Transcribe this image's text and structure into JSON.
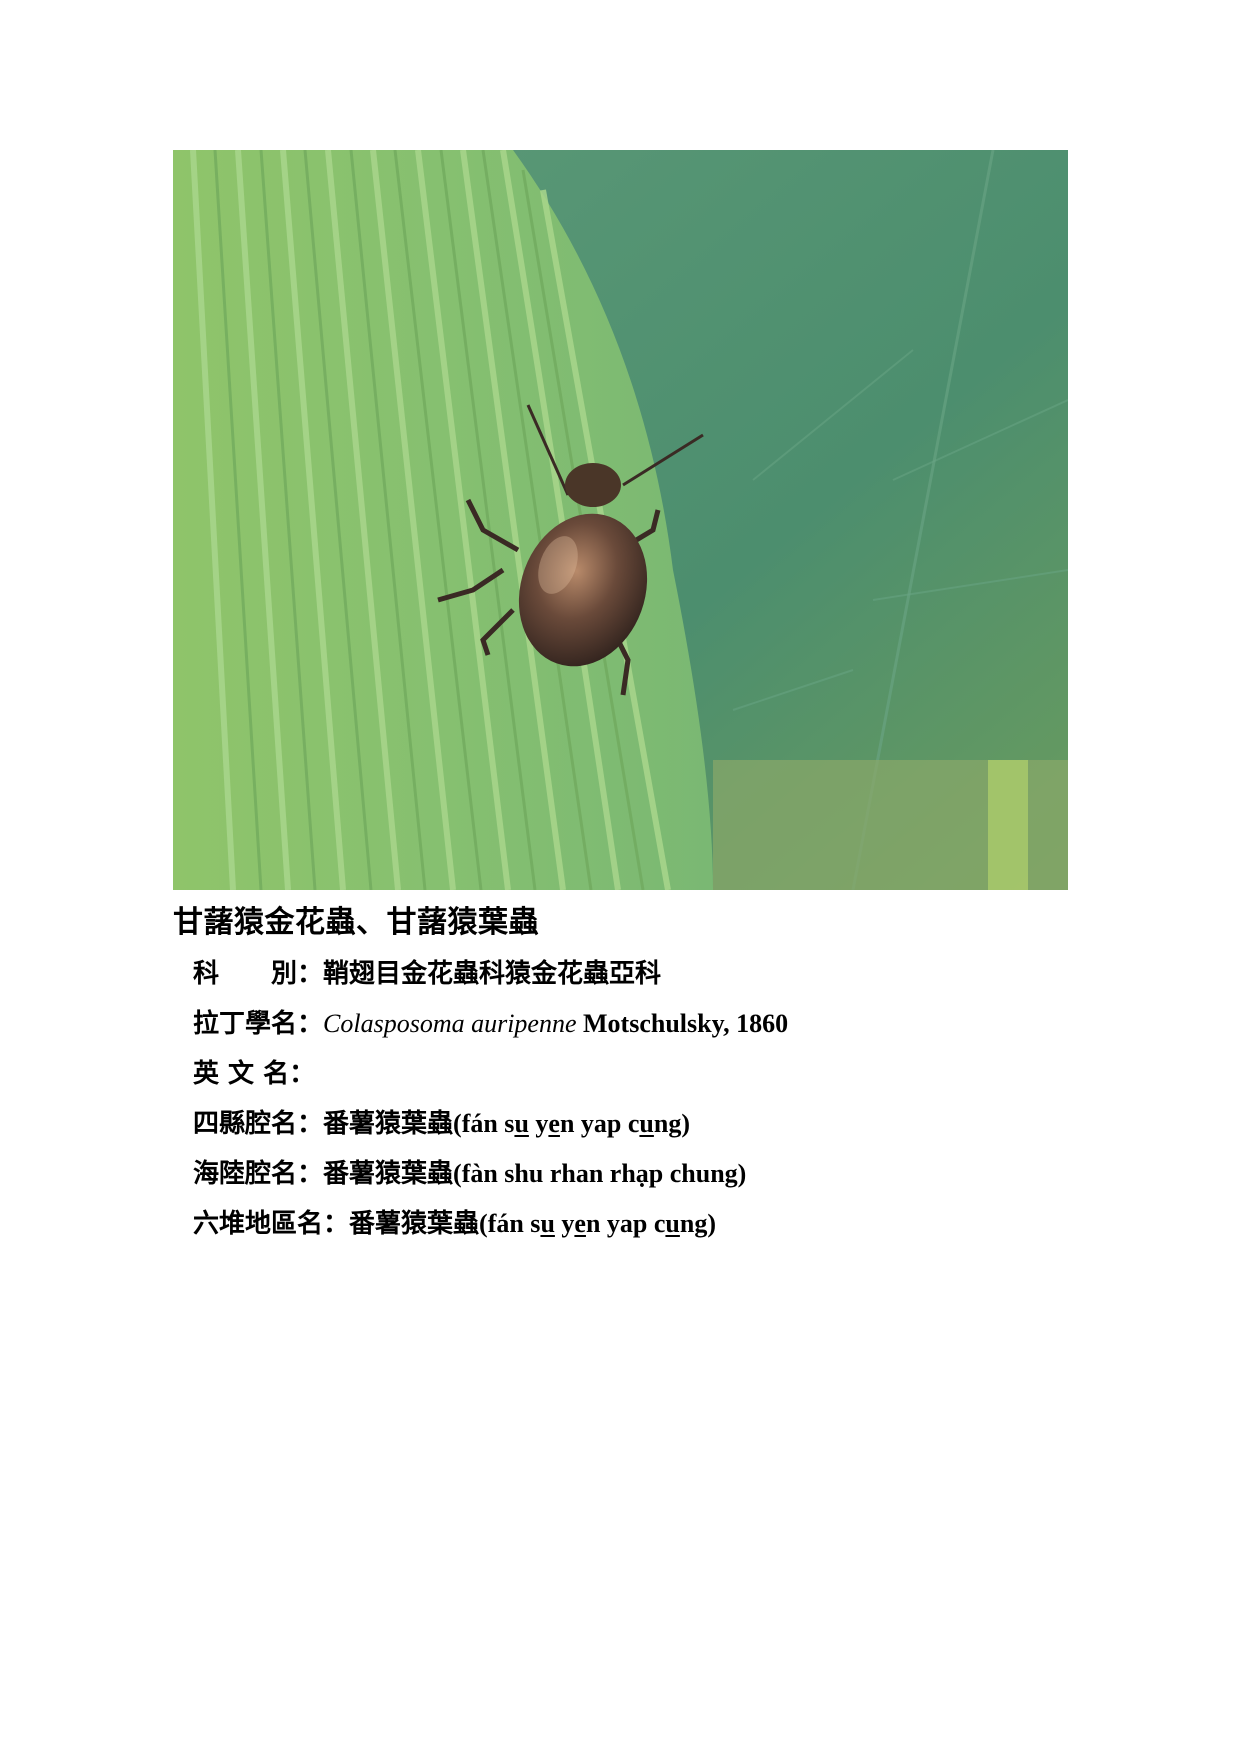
{
  "photo": {
    "subject": "beetle-on-leaf-photo"
  },
  "title": "甘藷猿金花蟲、甘藷猿葉蟲",
  "entries": {
    "family": {
      "label": "科　　別：",
      "value": "鞘翅目金花蟲科猿金花蟲亞科"
    },
    "latin": {
      "label": "拉丁學名：",
      "genus_species": "Colasposoma auripenne",
      "author": " Motschulsky, 1860"
    },
    "english": {
      "label": "英 文 名："
    },
    "sixian": {
      "label": "四縣腔名：",
      "name": "番薯猿葉蟲",
      "p1": "(fán s",
      "u1": "u",
      "p2": " ",
      "y": "y",
      "u2": "e",
      "p3": "n yap c",
      "u3": "u",
      "p4": "ng)"
    },
    "hailu": {
      "label": "海陸腔名：",
      "name": "番薯猿葉蟲",
      "roman": "(fàn shu rhan rhạp chung)"
    },
    "liudui": {
      "label": "六堆地區名：",
      "name": "番薯猿葉蟲",
      "p1": "(fán s",
      "u1": "u",
      "p2": " ",
      "y": "y",
      "u2": "e",
      "p3": "n yap c",
      "u3": "u",
      "p4": "ng)"
    }
  }
}
